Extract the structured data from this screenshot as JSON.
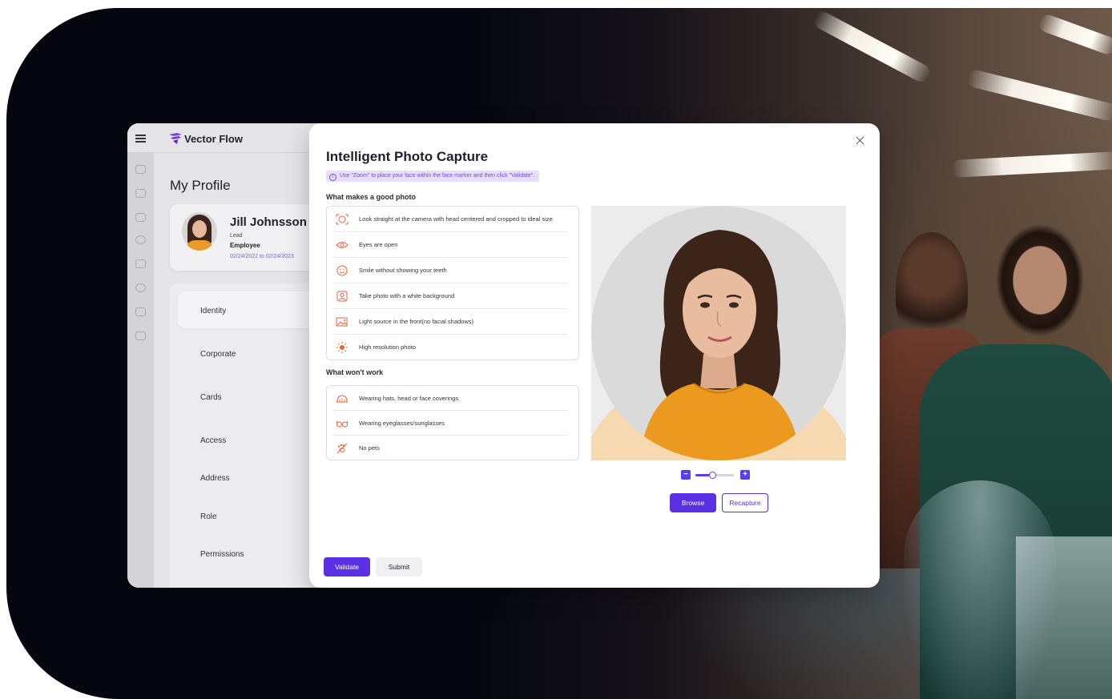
{
  "app": {
    "brand": "Vector Flow",
    "page_title": "My Profile",
    "profile": {
      "name": "Jill Johnsson",
      "title": "Lead",
      "role": "Employee",
      "dates": "02/24/2022 to 02/24/2023"
    },
    "nav_items": [
      "Identity",
      "Corporate",
      "Cards",
      "Access",
      "Address",
      "Role",
      "Permissions"
    ],
    "rail_icons": [
      "home-icon",
      "list-icon",
      "pin-icon",
      "history-icon",
      "chart-icon",
      "user-icon",
      "id-card-icon",
      "badge-icon"
    ]
  },
  "modal": {
    "title": "Intelligent Photo Capture",
    "hint": "Use \"Zoom\" to place your face within the face marker and then click \"Validate\".",
    "good_title": "What makes a good photo",
    "good_items": [
      {
        "text": "Look straight at the camera with head centered and cropped to ideal size",
        "icon": "face-target-icon"
      },
      {
        "text": "Eyes are open",
        "icon": "eye-icon"
      },
      {
        "text": "Smile without showing your teeth",
        "icon": "smile-icon"
      },
      {
        "text": "Take photo with a white background",
        "icon": "portrait-icon"
      },
      {
        "text": "Light source in the front(no facial shadows)",
        "icon": "image-light-icon"
      },
      {
        "text": "High resolution photo",
        "icon": "brightness-icon"
      }
    ],
    "bad_title": "What won't work",
    "bad_items": [
      {
        "text": "Wearing hats, head or face coverings",
        "icon": "hat-icon"
      },
      {
        "text": "Wearing eyeglasses/sunglasses",
        "icon": "glasses-icon"
      },
      {
        "text": "No pets",
        "icon": "no-pets-icon"
      }
    ],
    "zoom_level": 0.45,
    "browse_label": "Browse",
    "recapture_label": "Recapture",
    "validate_label": "Validate",
    "submit_label": "Submit"
  },
  "colors": {
    "accent": "#5b2fe3",
    "icon_orange": "#e8663b",
    "hint_bg": "#e8ddff"
  }
}
